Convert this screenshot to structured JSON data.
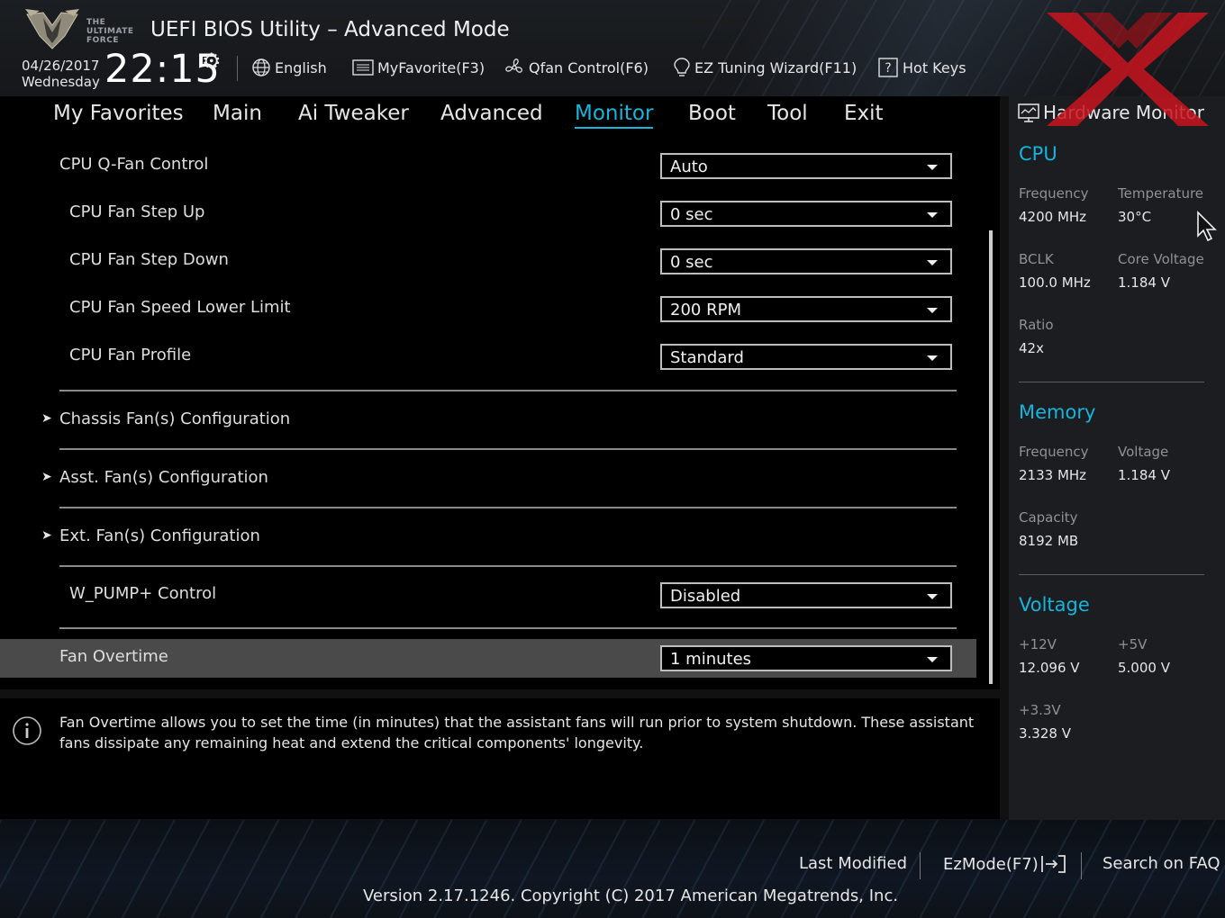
{
  "header": {
    "logo_text": [
      "THE",
      "ULTIMATE",
      "FORCE"
    ],
    "title": "UEFI BIOS Utility – Advanced Mode",
    "date": "04/26/2017",
    "weekday": "Wednesday",
    "time": "22:15",
    "buttons": [
      {
        "label": "English",
        "icon": "globe-icon"
      },
      {
        "label": "MyFavorite(F3)",
        "icon": "favorite-list-icon"
      },
      {
        "label": "Qfan Control(F6)",
        "icon": "fan-icon"
      },
      {
        "label": "EZ Tuning Wizard(F11)",
        "icon": "lightbulb-icon"
      },
      {
        "label": "Hot Keys",
        "icon": "question-box-icon"
      }
    ]
  },
  "nav": {
    "tabs": [
      "My Favorites",
      "Main",
      "Ai Tweaker",
      "Advanced",
      "Monitor",
      "Boot",
      "Tool",
      "Exit"
    ],
    "active": "Monitor"
  },
  "settings": [
    {
      "label": "CPU Q-Fan Control",
      "value": "Auto"
    },
    {
      "label": "CPU Fan Step Up",
      "value": "0 sec"
    },
    {
      "label": "CPU Fan Step Down",
      "value": "0 sec"
    },
    {
      "label": "CPU Fan Speed Lower Limit",
      "value": "200 RPM"
    },
    {
      "label": "CPU Fan Profile",
      "value": "Standard"
    }
  ],
  "submenus": [
    "Chassis Fan(s) Configuration",
    "Asst. Fan(s) Configuration",
    "Ext. Fan(s) Configuration"
  ],
  "wpump": {
    "label": "W_PUMP+ Control",
    "value": "Disabled"
  },
  "fan_overtime": {
    "label": "Fan Overtime",
    "value": "1 minutes"
  },
  "info": {
    "text": "Fan Overtime allows you to set the time (in minutes) that the assistant fans will run prior to system shutdown. These assistant fans dissipate any remaining heat and extend the critical components' longevity."
  },
  "hw_monitor": {
    "title": "Hardware Monitor",
    "cpu": {
      "heading": "CPU",
      "frequency_label": "Frequency",
      "frequency": "4200 MHz",
      "temperature_label": "Temperature",
      "temperature": "30°C",
      "bclk_label": "BCLK",
      "bclk": "100.0 MHz",
      "core_voltage_label": "Core Voltage",
      "core_voltage": "1.184 V",
      "ratio_label": "Ratio",
      "ratio": "42x"
    },
    "memory": {
      "heading": "Memory",
      "frequency_label": "Frequency",
      "frequency": "2133 MHz",
      "voltage_label": "Voltage",
      "voltage": "1.184 V",
      "capacity_label": "Capacity",
      "capacity": "8192 MB"
    },
    "voltage": {
      "heading": "Voltage",
      "v12_label": "+12V",
      "v12": "12.096 V",
      "v5_label": "+5V",
      "v5": "5.000 V",
      "v33_label": "+3.3V",
      "v33": "3.328 V"
    }
  },
  "footer": {
    "last_modified": "Last Modified",
    "ezmode": "EzMode(F7)",
    "search": "Search on FAQ",
    "version": "Version 2.17.1246. Copyright (C) 2017 American Megatrends, Inc."
  },
  "colors": {
    "accent": "#17b4dc",
    "highlight_row": "#4a4a4a",
    "watermark": "#c8141e"
  }
}
